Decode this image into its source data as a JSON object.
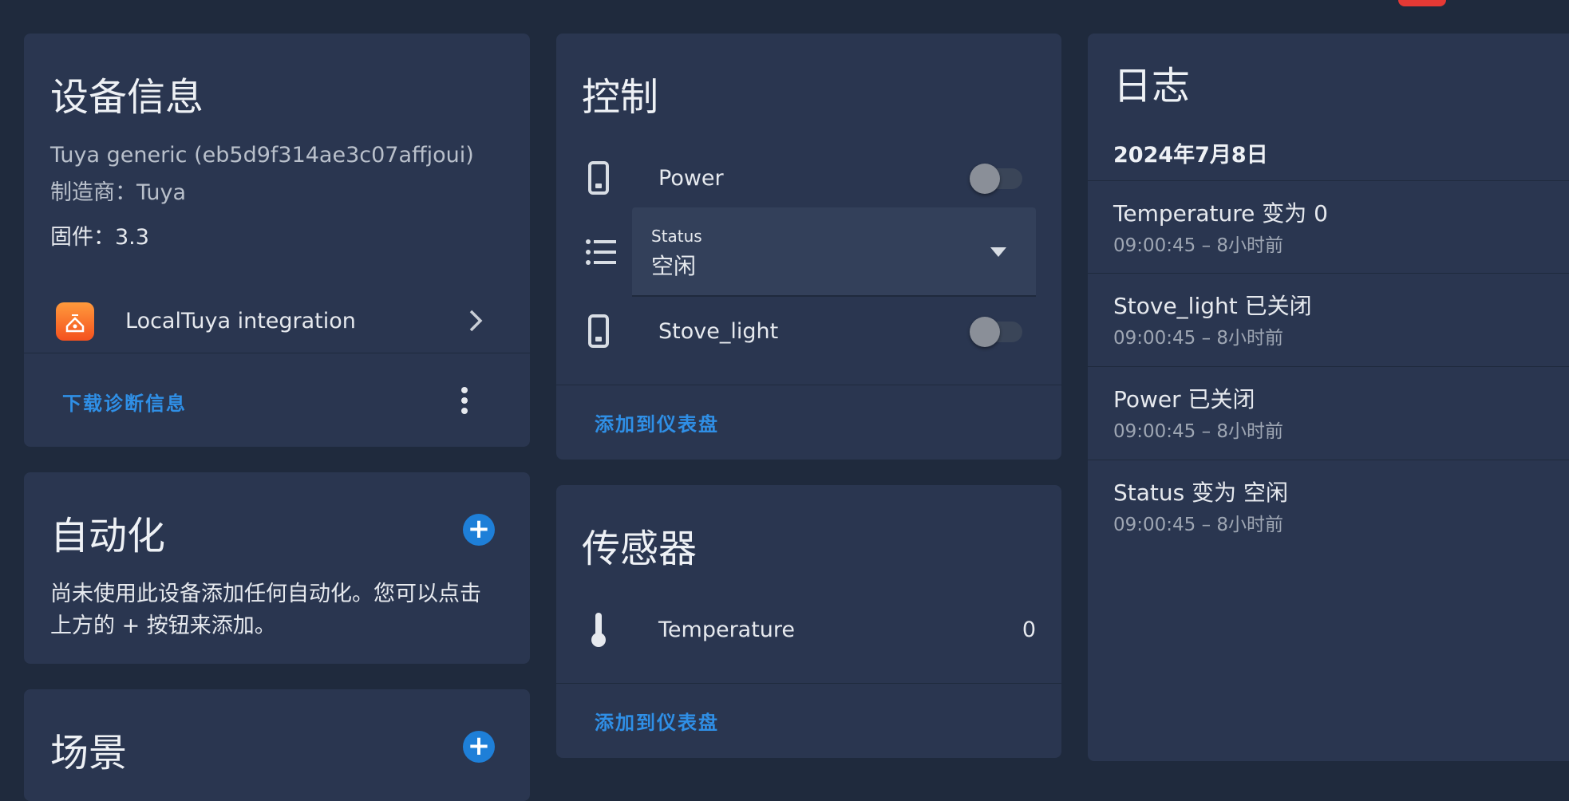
{
  "device_info": {
    "title": "设备信息",
    "model": "Tuya generic (eb5d9f314ae3c07affjoui)",
    "manufacturer": "制造商：Tuya",
    "firmware": "固件：3.3",
    "integration_label": "LocalTuya integration",
    "download_label": "下载诊断信息"
  },
  "automation": {
    "title": "自动化",
    "empty_line1": "尚未使用此设备添加任何自动化。您可以点击",
    "empty_line2": "上方的 + 按钮来添加。"
  },
  "scene": {
    "title": "场景"
  },
  "controls": {
    "title": "控制",
    "power_label": "Power",
    "power_on": false,
    "status_label": "Status",
    "status_value": "空闲",
    "stove_label": "Stove_light",
    "stove_on": false,
    "add_dashboard": "添加到仪表盘"
  },
  "sensors": {
    "title": "传感器",
    "temperature_label": "Temperature",
    "temperature_value": "0",
    "add_dashboard": "添加到仪表盘"
  },
  "logbook": {
    "title": "日志",
    "date": "2024年7月8日",
    "entries": [
      {
        "text": "Temperature 变为 0",
        "time": "09:00:45 – 8小时前"
      },
      {
        "text": "Stove_light 已关闭",
        "time": "09:00:45 – 8小时前"
      },
      {
        "text": "Power 已关闭",
        "time": "09:00:45 – 8小时前"
      },
      {
        "text": "Status 变为 空闲",
        "time": "09:00:45 – 8小时前"
      }
    ]
  },
  "colors": {
    "accent": "#2f8fe6",
    "card": "#2a3650",
    "background": "#1f2a3d",
    "badge": "#e53935"
  }
}
